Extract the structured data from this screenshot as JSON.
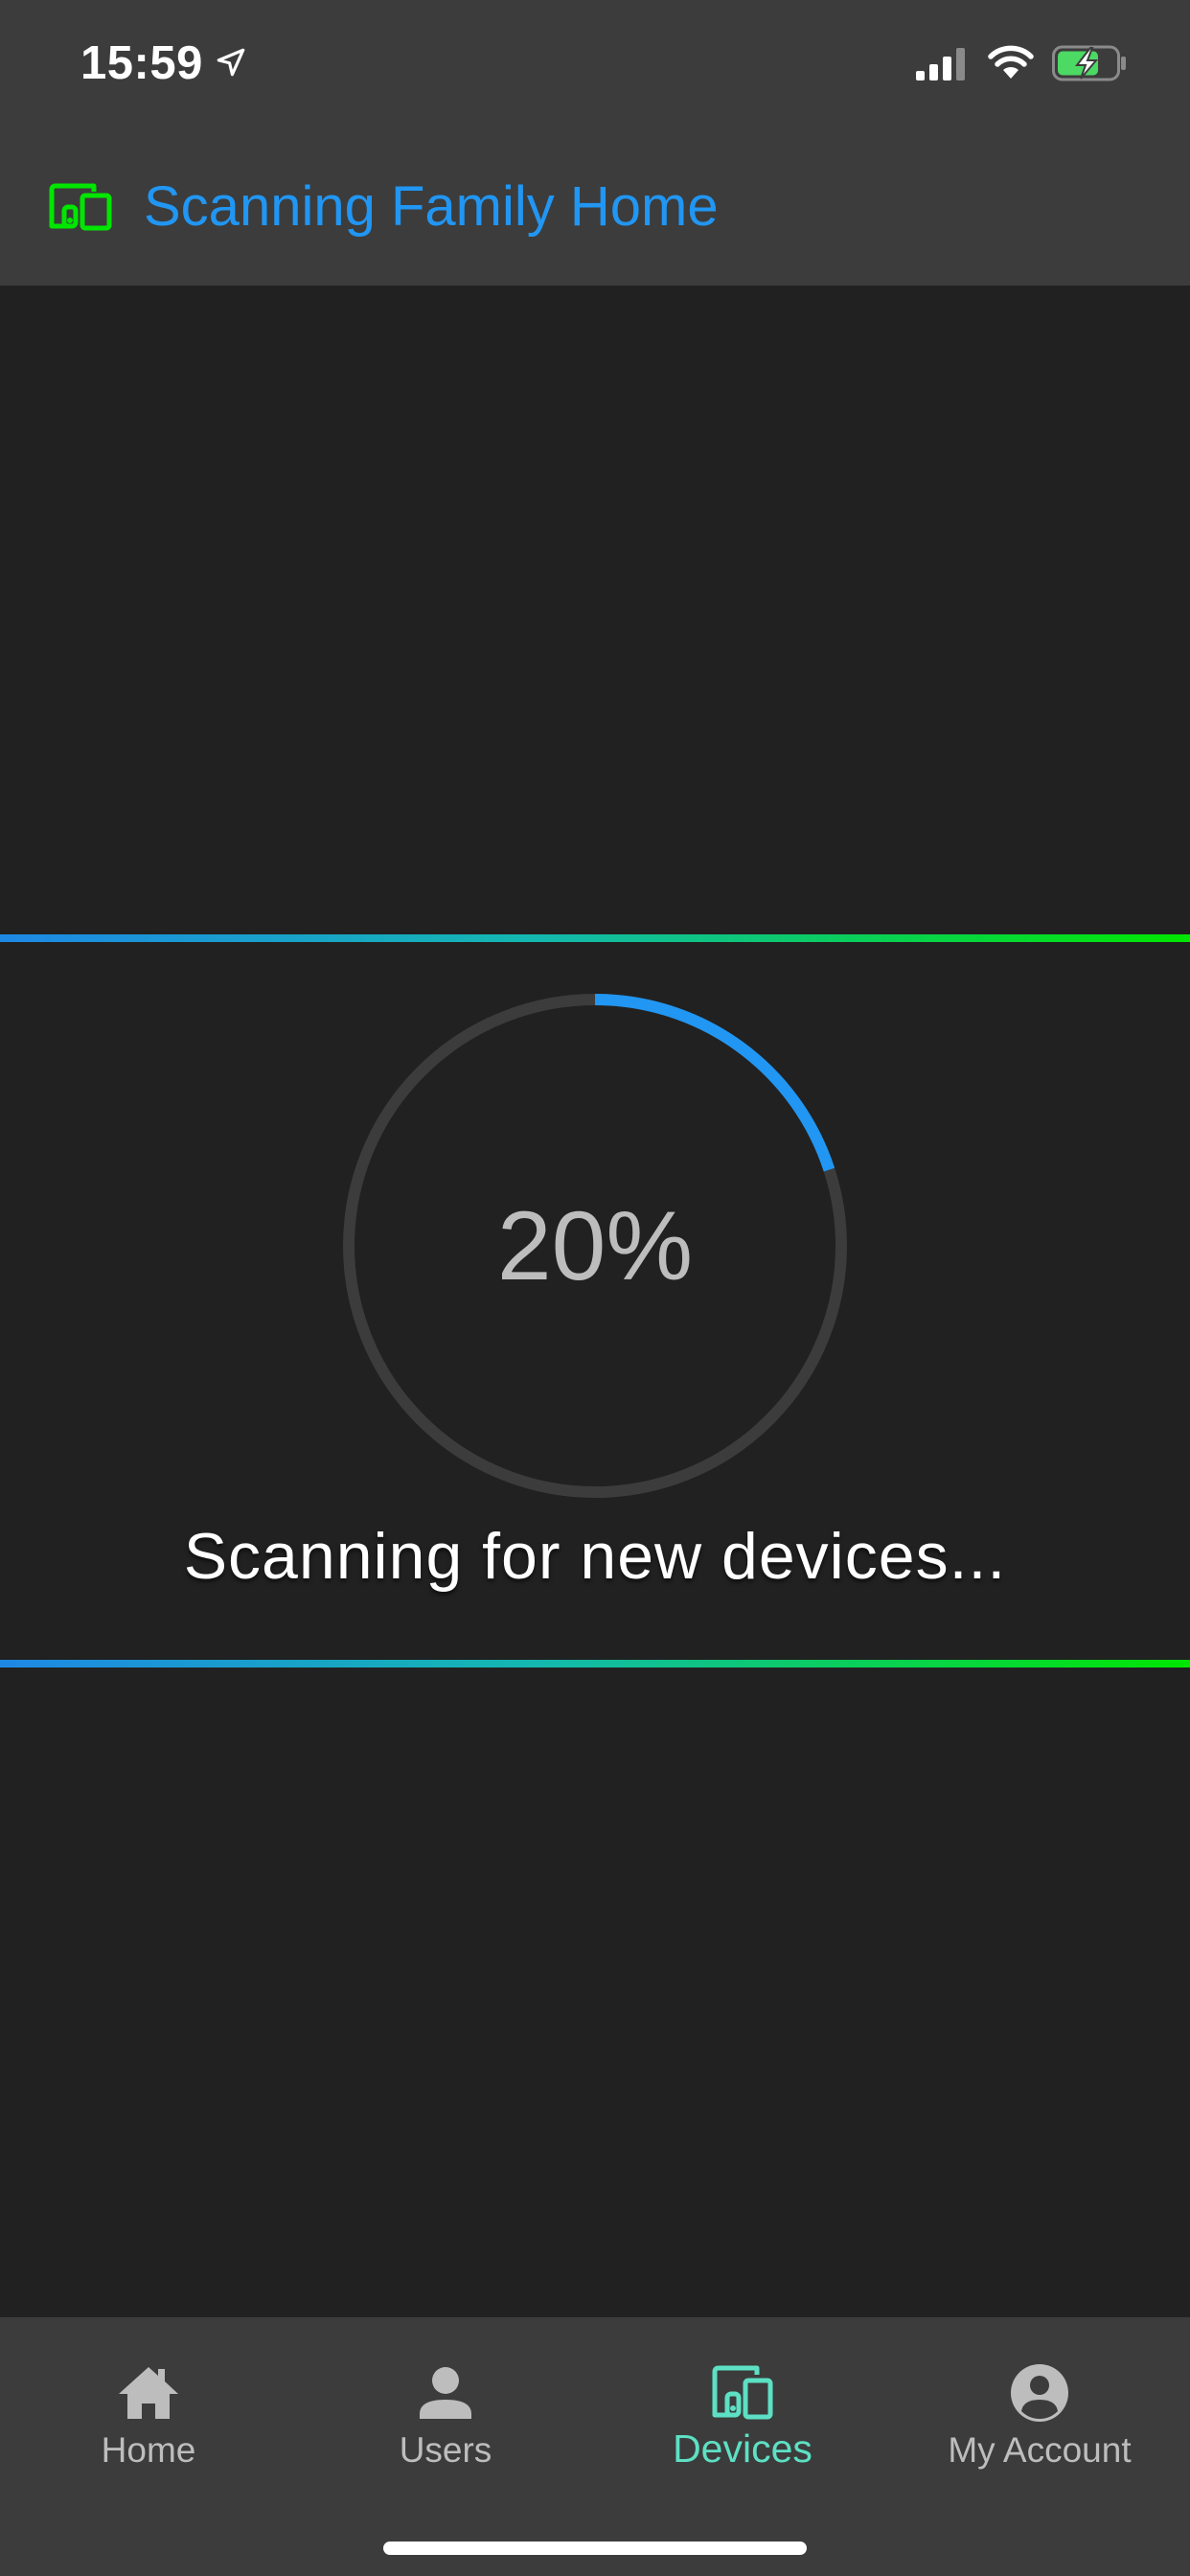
{
  "status_bar": {
    "time": "15:59",
    "icons": [
      "location-arrow-icon",
      "cellular-signal-icon",
      "wifi-icon",
      "battery-charging-icon"
    ],
    "battery_color": "#4cd964"
  },
  "header": {
    "icon": "devices-icon",
    "icon_color": "#00e600",
    "title": "Scanning Family Home",
    "title_color": "#2196f3"
  },
  "scan": {
    "progress_percent": 20,
    "progress_label": "20%",
    "status_text": "Scanning for new devices...",
    "accent_color": "#2196f3"
  },
  "bottom_nav": {
    "items": [
      {
        "label": "Home",
        "icon": "home-icon",
        "active": false
      },
      {
        "label": "Users",
        "icon": "user-icon",
        "active": false
      },
      {
        "label": "Devices",
        "icon": "devices-icon",
        "active": true
      },
      {
        "label": "My Account",
        "icon": "account-circle-icon",
        "active": false
      }
    ],
    "active_color": "#5de0c4",
    "inactive_color": "#bdbdbd"
  }
}
